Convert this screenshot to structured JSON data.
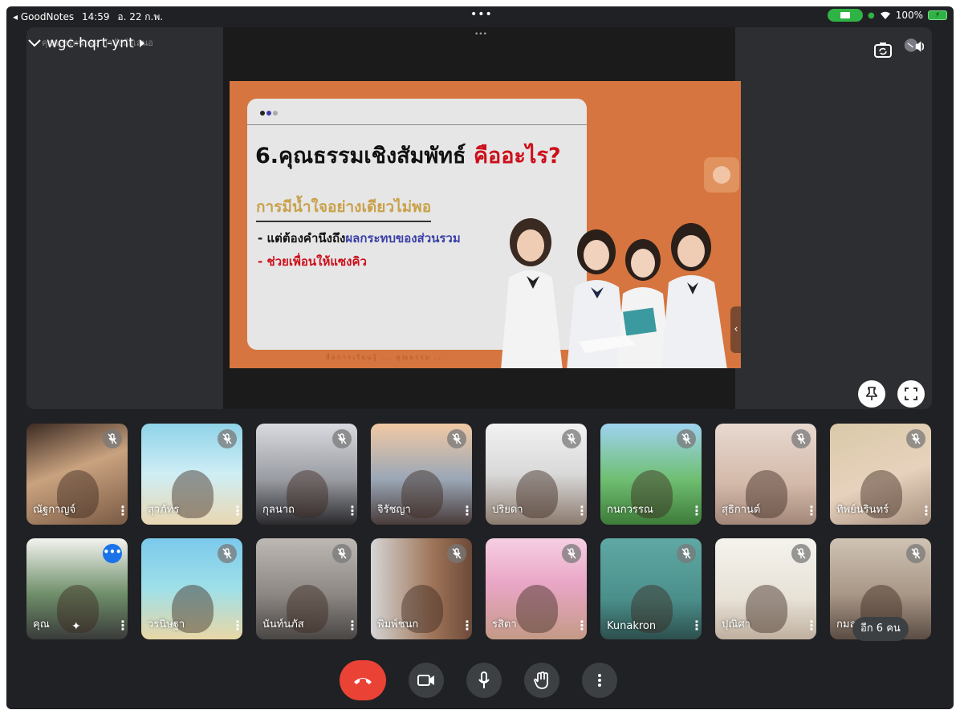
{
  "status_bar": {
    "back_app": "◂ GoodNotes",
    "time": "14:59",
    "date": "อ. 22 ก.พ.",
    "center_dots": "•••",
    "battery": "100%"
  },
  "meeting": {
    "code": "wgc-hqrt-ynt",
    "ghost_subtitle": "คุณแชร์หน้าจอ กำลังนำเสนอ",
    "top_dots": "•••"
  },
  "slide": {
    "title_main": "6.คุณธรรมเชิงสัมพัทธ์",
    "title_red": "คืออะไร?",
    "subtitle": "การมีน้ำใจอย่างเดียวไม่พอ",
    "bullet1_prefix": "- แต่ต้องคำนึงถึง",
    "bullet1_highlight": "ผลกระทบของส่วนรวม",
    "bullet2": "- ช่วยเพื่อนให้แซงคิว",
    "footer": "สื่อการเรียนรู้ ... คุณธรรม ...",
    "chevron": "‹"
  },
  "participants": [
    {
      "name": "ณัฐกาญจ์",
      "bg": "face1"
    },
    {
      "name": "สุวภัทร",
      "bg": "beach"
    },
    {
      "name": "กุลนาถ",
      "bg": "room"
    },
    {
      "name": "จิรัชญา",
      "bg": "city"
    },
    {
      "name": "ปริยดา",
      "bg": "curtain"
    },
    {
      "name": "กนกวรรณ",
      "bg": "forest"
    },
    {
      "name": "สุธิกานต์",
      "bg": "wall"
    },
    {
      "name": "ทิพย์นรินทร์",
      "bg": "blur"
    },
    {
      "name": "คุณ",
      "bg": "self"
    },
    {
      "name": "วรนิษฐา",
      "bg": "island"
    },
    {
      "name": "นันท์นภัส",
      "bg": "grey"
    },
    {
      "name": "พิมพ์ชนก",
      "bg": "door"
    },
    {
      "name": "รสิตา",
      "bg": "poster"
    },
    {
      "name": "Kunakron",
      "bg": "teal"
    },
    {
      "name": "ปุณิศา",
      "bg": "white"
    },
    {
      "name": "กมลร",
      "bg": "brown"
    }
  ],
  "more_people_label": "อีก 6 คน",
  "self_menu_label": "•••",
  "more_glyph": "⋮",
  "colors": {
    "end_call": "#ea4335",
    "background": "#202124",
    "slide_orange": "#d6753f",
    "title_red": "#cc0f1a",
    "subtitle_gold": "#c9a14b",
    "bullet_blue": "#3b3fa8",
    "bullet_red": "#cc0f1a"
  },
  "icons": {
    "collapse": "chevron-down-icon",
    "camera_flip": "camera-flip-icon",
    "speaker": "speaker-icon",
    "pin": "pin-icon",
    "fullscreen": "fullscreen-icon",
    "mic_off": "mic-off-icon",
    "camera": "camera-icon",
    "mic": "mic-icon",
    "hand": "raise-hand-icon",
    "more": "more-vertical-icon",
    "end_call": "end-call-icon"
  }
}
